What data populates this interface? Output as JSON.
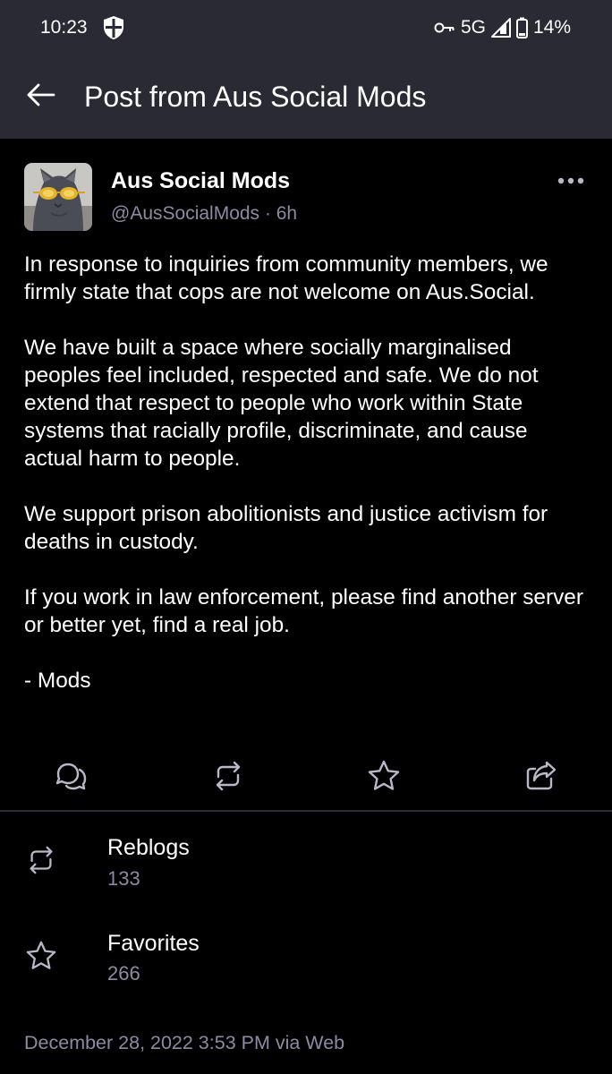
{
  "status_bar": {
    "time": "10:23",
    "network": "5G",
    "battery": "14%"
  },
  "app_bar": {
    "title": "Post from Aus Social Mods"
  },
  "post": {
    "display_name": "Aus Social Mods",
    "handle": "@AusSocialMods",
    "separator": "·",
    "age": "6h",
    "paragraphs": [
      "In response to inquiries from community members, we firmly state that cops are not welcome on Aus.Social.",
      "We have built a space where socially marginalised peoples feel included, respected and safe. We do not extend that respect to people who work within State systems that racially profile, discriminate, and cause actual harm to people.",
      "We support prison abolitionists and justice activism for deaths in custody.",
      "If you work in law enforcement, please find another server or better yet, find a real job.",
      "- Mods"
    ]
  },
  "actions": {
    "icons": [
      "reply-icon",
      "reblog-icon",
      "favourite-icon",
      "share-icon"
    ]
  },
  "stats": {
    "reblogs_label": "Reblogs",
    "reblogs_count": "133",
    "favorites_label": "Favorites",
    "favorites_count": "266"
  },
  "footer": {
    "timestamp": "December 28, 2022 3:53 PM via Web"
  },
  "colors": {
    "app_bar_bg": "#2a2a35",
    "page_bg": "#000000",
    "muted_text": "#8d8aa4",
    "divider": "#2e2d3a"
  }
}
